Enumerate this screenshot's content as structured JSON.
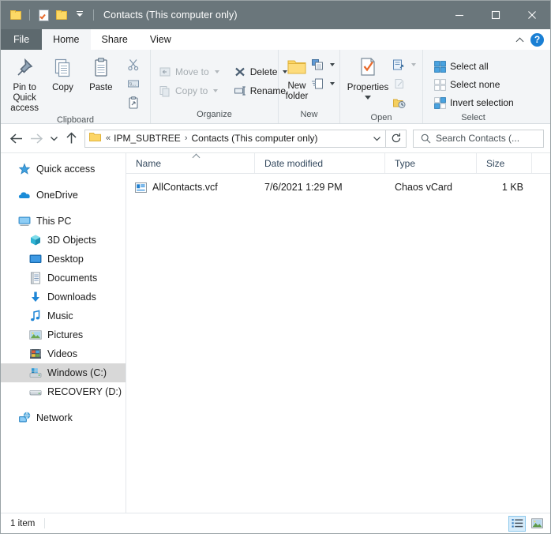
{
  "window": {
    "title": "Contacts (This computer only)",
    "quick_access_toolbar": [
      {
        "name": "folder-icon",
        "label": "Explorer"
      },
      {
        "name": "properties-icon",
        "label": "Properties"
      },
      {
        "name": "new-folder-icon",
        "label": "New folder"
      },
      {
        "name": "customize-quick-access-toolbar-icon",
        "label": "Customize Quick Access Toolbar"
      }
    ],
    "controls": {
      "minimize": "Minimize",
      "maximize": "Maximize",
      "close": "Close"
    },
    "titlebar_color": "#6a767b"
  },
  "ribbon": {
    "tabs": [
      {
        "label": "File",
        "active": false,
        "is_file": true
      },
      {
        "label": "Home",
        "active": true,
        "is_file": false
      },
      {
        "label": "Share",
        "active": false,
        "is_file": false
      },
      {
        "label": "View",
        "active": false,
        "is_file": false
      }
    ],
    "collapse_label": "Minimize the Ribbon",
    "help_label": "?",
    "groups": {
      "clipboard": {
        "label": "Clipboard",
        "pin_label": "Pin to Quick\naccess",
        "pin_line1": "Pin to Quick",
        "pin_line2": "access",
        "copy_label": "Copy",
        "paste_label": "Paste",
        "cut_label": "Cut",
        "copy_path_label": "Copy path",
        "paste_shortcut_label": "Paste shortcut"
      },
      "organize": {
        "label": "Organize",
        "move_to_label": "Move to",
        "copy_to_label": "Copy to",
        "delete_label": "Delete",
        "rename_label": "Rename"
      },
      "new": {
        "label": "New",
        "new_folder_line1": "New",
        "new_folder_line2": "folder",
        "new_item_label": "New item",
        "easy_access_label": "Easy access"
      },
      "open": {
        "label": "Open",
        "properties_label": "Properties",
        "open_label": "Open",
        "edit_label": "Edit",
        "history_label": "History"
      },
      "select": {
        "label": "Select",
        "select_all_label": "Select all",
        "select_none_label": "Select none",
        "invert_selection_label": "Invert selection"
      }
    }
  },
  "addressbar": {
    "back_label": "Back",
    "forward_label": "Forward",
    "recent_label": "Recent locations",
    "up_label": "Up",
    "breadcrumb": [
      {
        "label": "«",
        "is_overflow": true
      },
      {
        "label": "IPM_SUBTREE",
        "is_overflow": false
      },
      {
        "label": "Contacts (This computer only)",
        "is_overflow": false
      }
    ],
    "dropdown_label": "Previous locations",
    "refresh_label": "Refresh"
  },
  "search": {
    "placeholder": "Search Contacts (...",
    "icon": "search-icon"
  },
  "navigation": {
    "items": [
      {
        "label": "Quick access",
        "icon": "quick-access-star-icon",
        "level": 0,
        "selected": false,
        "gap_after": true
      },
      {
        "label": "OneDrive",
        "icon": "onedrive-cloud-icon",
        "level": 0,
        "selected": false,
        "gap_after": true
      },
      {
        "label": "This PC",
        "icon": "this-pc-monitor-icon",
        "level": 0,
        "selected": false,
        "gap_after": false
      },
      {
        "label": "3D Objects",
        "icon": "3d-objects-icon",
        "level": 1,
        "selected": false,
        "gap_after": false
      },
      {
        "label": "Desktop",
        "icon": "desktop-icon",
        "level": 1,
        "selected": false,
        "gap_after": false
      },
      {
        "label": "Documents",
        "icon": "documents-icon",
        "level": 1,
        "selected": false,
        "gap_after": false
      },
      {
        "label": "Downloads",
        "icon": "downloads-arrow-icon",
        "level": 1,
        "selected": false,
        "gap_after": false
      },
      {
        "label": "Music",
        "icon": "music-note-icon",
        "level": 1,
        "selected": false,
        "gap_after": false
      },
      {
        "label": "Pictures",
        "icon": "pictures-icon",
        "level": 1,
        "selected": false,
        "gap_after": false
      },
      {
        "label": "Videos",
        "icon": "videos-film-icon",
        "level": 1,
        "selected": false,
        "gap_after": false
      },
      {
        "label": "Windows (C:)",
        "icon": "local-disk-icon",
        "level": 1,
        "selected": true,
        "gap_after": false
      },
      {
        "label": "RECOVERY (D:)",
        "icon": "local-disk-icon",
        "level": 1,
        "selected": false,
        "gap_after": true
      },
      {
        "label": "Network",
        "icon": "network-icon",
        "level": 0,
        "selected": false,
        "gap_after": false
      }
    ],
    "selection_color": "#d8d8d8"
  },
  "filelist": {
    "columns": [
      {
        "label": "Name",
        "key": "name",
        "sorted": true,
        "sort_direction": "ascending"
      },
      {
        "label": "Date modified",
        "key": "date",
        "sorted": false,
        "sort_direction": ""
      },
      {
        "label": "Type",
        "key": "type",
        "sorted": false,
        "sort_direction": ""
      },
      {
        "label": "Size",
        "key": "size",
        "sorted": false,
        "sort_direction": ""
      }
    ],
    "rows": [
      {
        "name": "AllContacts.vcf",
        "date": "7/6/2021 1:29 PM",
        "type": "Chaos vCard",
        "size": "1 KB",
        "icon": "vcard-file-icon"
      }
    ]
  },
  "statusbar": {
    "item_count": "1 item",
    "view_buttons": [
      {
        "name": "details-view-button",
        "label": "Details view",
        "active": true
      },
      {
        "name": "large-icons-view-button",
        "label": "Large icons view",
        "active": false
      }
    ]
  }
}
